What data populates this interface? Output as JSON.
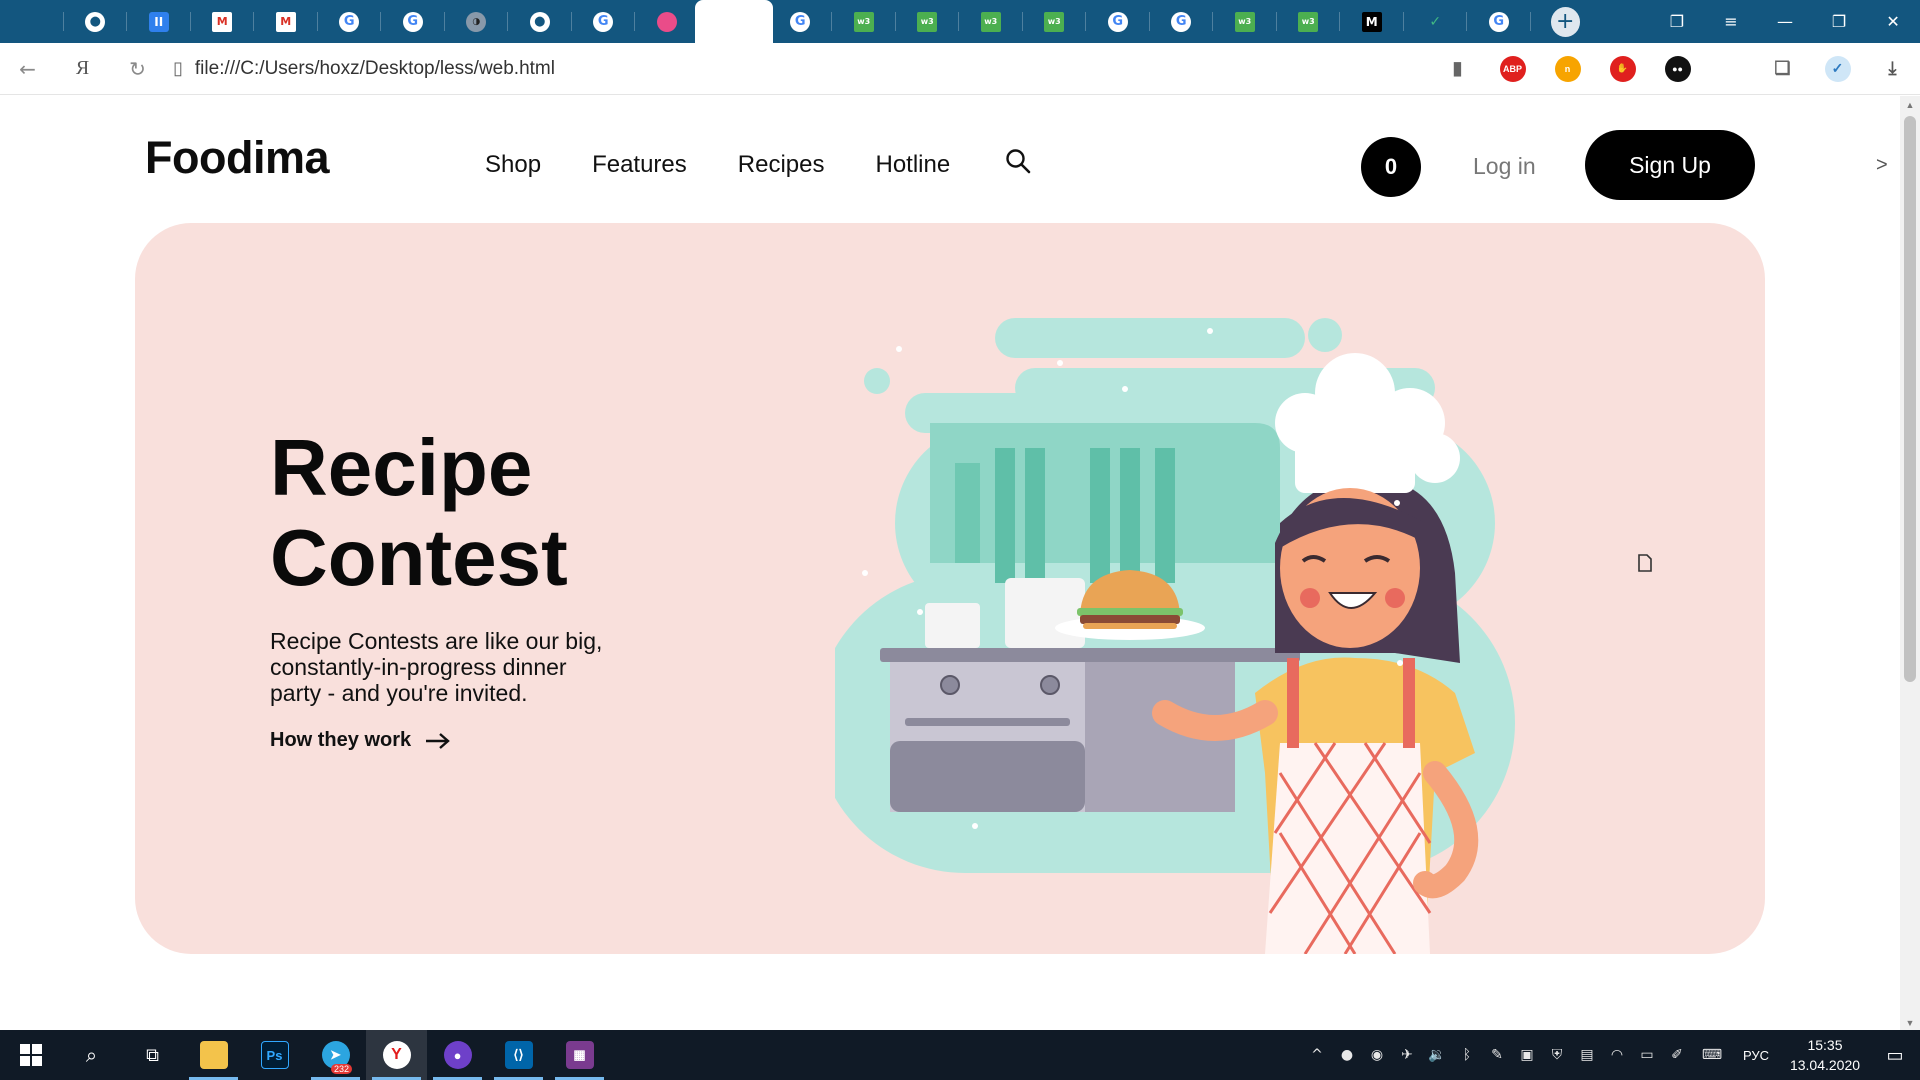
{
  "browser": {
    "tabs": [
      {
        "icon": "page-icon",
        "glyph": ""
      },
      {
        "icon": "github-icon",
        "glyph": "●"
      },
      {
        "icon": "pause-icon",
        "glyph": "II"
      },
      {
        "icon": "gmail-icon",
        "glyph": "M"
      },
      {
        "icon": "gmail-icon",
        "glyph": "M"
      },
      {
        "icon": "google-icon",
        "glyph": "G"
      },
      {
        "icon": "google-icon",
        "glyph": "G"
      },
      {
        "icon": "mask-icon",
        "glyph": "◑"
      },
      {
        "icon": "github-icon",
        "glyph": "●"
      },
      {
        "icon": "google-icon",
        "glyph": "G"
      },
      {
        "icon": "dribbble-icon",
        "glyph": ""
      },
      {
        "icon": "page-icon",
        "glyph": "",
        "active": true
      },
      {
        "icon": "google-icon",
        "glyph": "G"
      },
      {
        "icon": "w3schools-icon",
        "glyph": "w3"
      },
      {
        "icon": "w3schools-icon",
        "glyph": "w3"
      },
      {
        "icon": "w3schools-icon",
        "glyph": "w3"
      },
      {
        "icon": "w3schools-icon",
        "glyph": "w3"
      },
      {
        "icon": "google-icon",
        "glyph": "G"
      },
      {
        "icon": "google-icon",
        "glyph": "G"
      },
      {
        "icon": "w3schools-icon",
        "glyph": "w3"
      },
      {
        "icon": "w3schools-icon",
        "glyph": "w3"
      },
      {
        "icon": "medium-icon",
        "glyph": "M"
      },
      {
        "icon": "vue-icon",
        "glyph": "✓"
      },
      {
        "icon": "google-icon",
        "glyph": "G"
      }
    ],
    "address": "file:///C:/Users/hoxz/Desktop/less/web.html",
    "extensions": [
      {
        "name": "adblock-icon",
        "label": "ABP",
        "color": "#e0201e"
      },
      {
        "name": "extension-orange-icon",
        "label": "n",
        "color": "#f7a400"
      },
      {
        "name": "stop-hand-icon",
        "label": "✋",
        "color": "#e0201e"
      },
      {
        "name": "extension-dark-icon",
        "label": "●●",
        "color": "#111111"
      }
    ]
  },
  "site": {
    "logo": "Foodima",
    "menu": [
      "Shop",
      "Features",
      "Recipes",
      "Hotline"
    ],
    "cart_count": "0",
    "login_label": "Log in",
    "signup_label": "Sign Up",
    "more_glyph": ">"
  },
  "hero": {
    "title_line1": "Recipe",
    "title_line2": "Contest",
    "text": "Recipe Contests are like our big, constantly-in-progress dinner party - and you're invited.",
    "link_label": "How they work",
    "background": "#f9e0dc"
  },
  "taskbar": {
    "telegram_badge": "232",
    "language": "РУС",
    "time": "15:35",
    "date": "13.04.2020"
  }
}
